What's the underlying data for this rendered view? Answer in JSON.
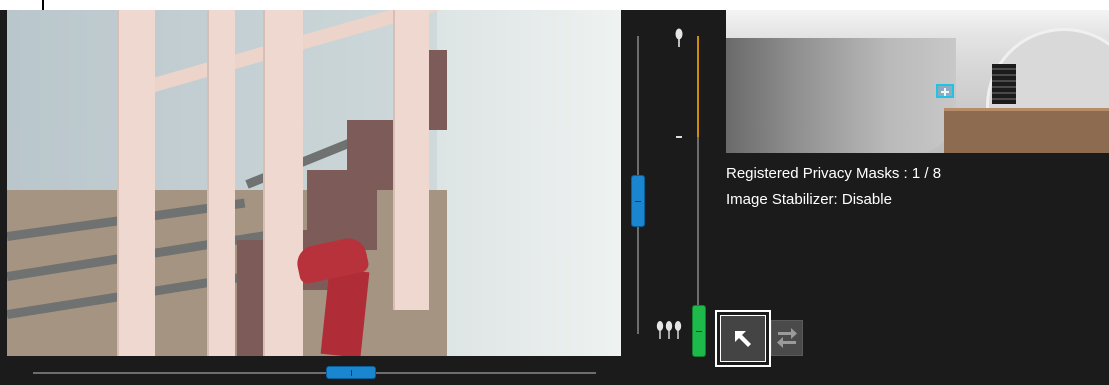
{
  "info": {
    "privacy_masks": "Registered Privacy Masks : 1 / 8",
    "image_stabilizer": "Image Stabilizer: Disable"
  },
  "controls": {
    "pan_position_percent": 55,
    "tilt_position_percent": 55,
    "zoom_position_percent": 0
  },
  "buttons": {
    "select_tool": "select-arrow-icon",
    "swap_tool": "swap-arrows-icon"
  },
  "colors": {
    "background": "#1b1b1b",
    "slider_blue": "#1a86d0",
    "zoom_green": "#1db94a",
    "zoom_track_gold": "#d08a0e",
    "mask_marker": "#1ec3e8"
  }
}
